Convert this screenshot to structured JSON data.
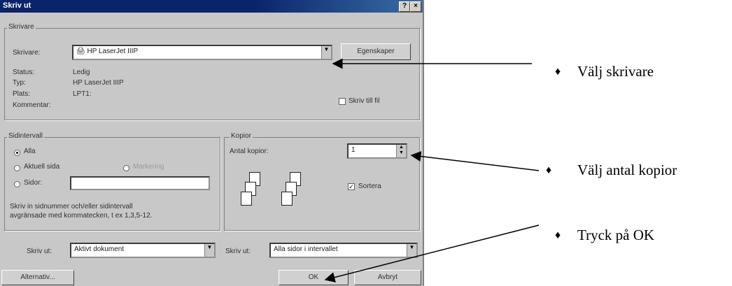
{
  "dialog": {
    "title": "Skriv ut",
    "help_label": "?",
    "close_label": "×",
    "printer_group": "Skrivare",
    "printer_label": "Skrivare:",
    "printer_value": "HP LaserJet IIIP",
    "properties_label": "Egenskaper",
    "status_label": "Status:",
    "status_value": "Ledig",
    "type_label": "Typ:",
    "type_value": "HP LaserJet IIIP",
    "location_label": "Plats:",
    "location_value": "LPT1:",
    "comment_label": "Kommentar:",
    "print_to_file_label": "Skriv till fil",
    "range_group": "Sidintervall",
    "range_all": "Alla",
    "range_current": "Aktuell sida",
    "range_selection": "Markering",
    "range_pages": "Sidor:",
    "range_hint_1": "Skriv in sidnummer och/eller sidintervall",
    "range_hint_2": "avgränsade med kommatecken, t ex 1,3,5-12.",
    "copies_group": "Kopior",
    "copies_label": "Antal kopior:",
    "copies_value": "1",
    "collate_label": "Sortera",
    "print_what_label": "Skriv ut:",
    "print_what_value": "Aktivt dokument",
    "print_label": "Skriv ut:",
    "print_value": "Alla sidor i intervallet",
    "options_label": "Alternativ...",
    "ok_label": "OK",
    "cancel_label": "Avbryt"
  },
  "annotations": {
    "bullet": "♦",
    "select_printer": "Välj skrivare",
    "select_copies": "Välj antal kopior",
    "press_ok": "Tryck på OK"
  }
}
